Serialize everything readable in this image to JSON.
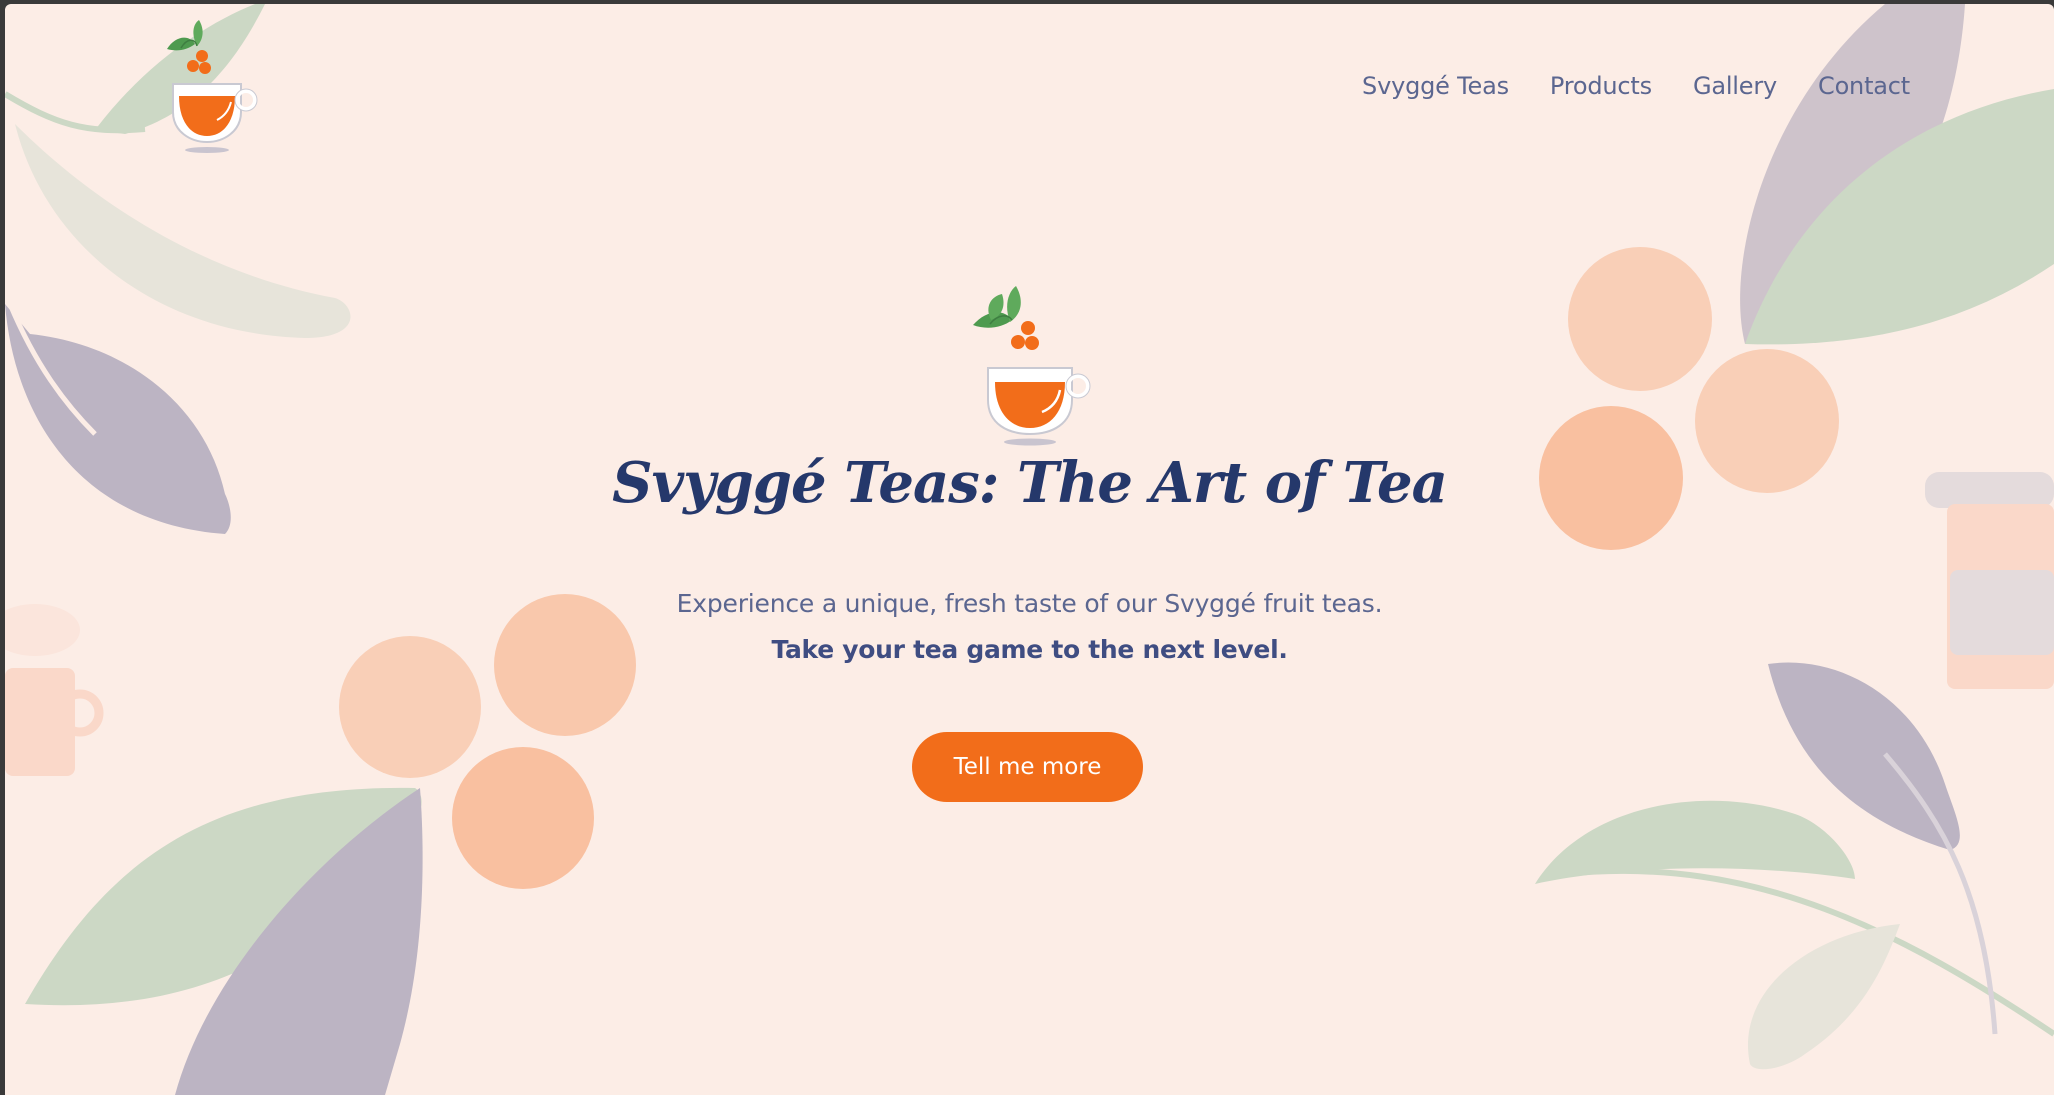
{
  "brand": {
    "logo_icon": "teacup-with-berries-icon"
  },
  "nav": {
    "items": [
      {
        "label": "Svyggé Teas"
      },
      {
        "label": "Products"
      },
      {
        "label": "Gallery"
      },
      {
        "label": "Contact"
      }
    ]
  },
  "hero": {
    "title": "Svyggé Teas: The Art of Tea",
    "subtitle": "Experience a unique, fresh taste of our Svyggé fruit teas.",
    "tagline": "Take your tea game to the next level.",
    "cta_label": "Tell me more"
  },
  "colors": {
    "background": "#fcede6",
    "accent": "#f26d1a",
    "title": "#25386b",
    "text": "#5b6690"
  }
}
